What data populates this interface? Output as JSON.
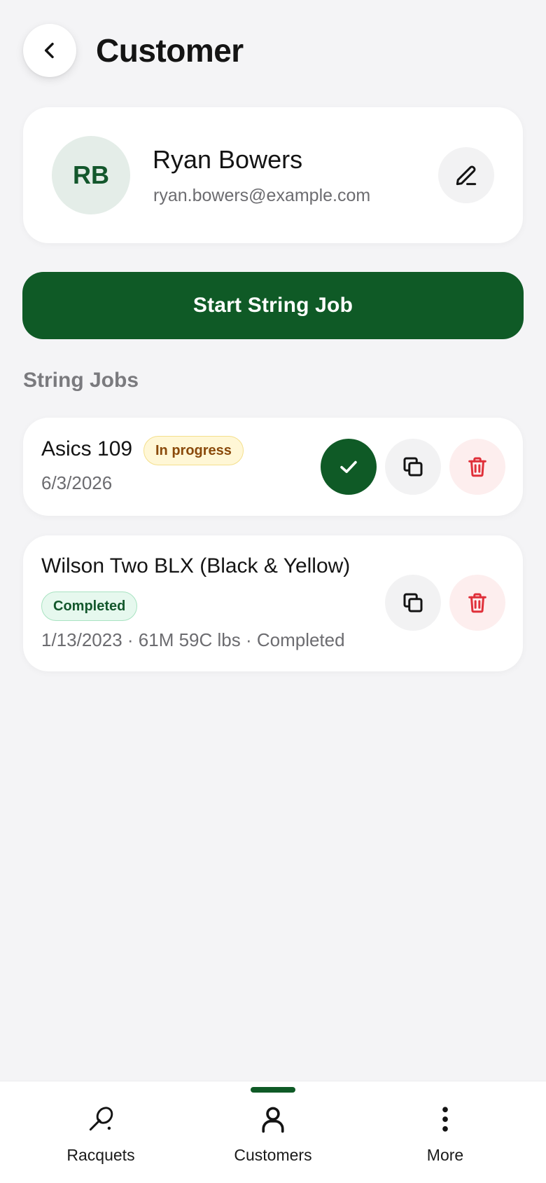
{
  "header": {
    "back_icon": "chevron-left-icon",
    "title": "Customer"
  },
  "customer": {
    "initials": "RB",
    "name": "Ryan Bowers",
    "email": "ryan.bowers@example.com",
    "edit_icon": "pencil-icon"
  },
  "actions": {
    "start_label": "Start String Job"
  },
  "jobs_section": {
    "title": "String Jobs",
    "jobs": [
      {
        "title": "Asics 109",
        "status": "In progress",
        "meta": "6/3/2026",
        "actions": [
          "check-icon",
          "copy-icon",
          "trash-icon"
        ]
      },
      {
        "title": "Wilson Two BLX (Black & Yellow)",
        "status": "Completed",
        "meta": "1/13/2023 · 61M 59C lbs · Completed",
        "actions": [
          "copy-icon",
          "trash-icon"
        ]
      }
    ]
  },
  "bottom_nav": {
    "items": [
      {
        "label": "Racquets",
        "icon": "racquet-icon"
      },
      {
        "label": "Customers",
        "icon": "person-icon",
        "active": true
      },
      {
        "label": "More",
        "icon": "more-vertical-icon"
      }
    ]
  },
  "colors": {
    "brand_green": "#0f5a26",
    "background": "#f4f4f6",
    "delete_red": "#e0303a",
    "in_progress_badge": "#fff7d6",
    "completed_badge": "#e6f8ee"
  }
}
